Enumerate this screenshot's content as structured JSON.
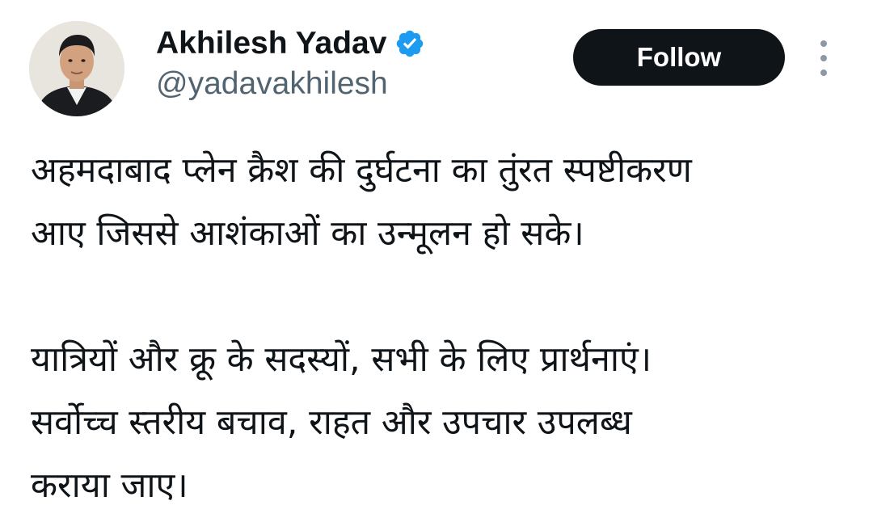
{
  "author": {
    "display_name": "Akhilesh Yadav",
    "handle": "@yadavakhilesh",
    "verified_icon": "verified-badge-icon",
    "avatar_icon": "profile-photo"
  },
  "actions": {
    "follow_label": "Follow",
    "more_icon": "more-vertical-icon"
  },
  "colors": {
    "text_primary": "#0f1419",
    "text_secondary": "#536471",
    "follow_bg": "#0f1419",
    "verified_blue": "#1d9bf0"
  },
  "tweet": {
    "paragraphs": [
      {
        "lines": [
          "अहमदाबाद प्लेन क्रैश की दुर्घटना का तुंरत स्पष्टीकरण",
          "आए जिससे आशंकाओं का उन्मूलन हो सके।"
        ]
      },
      {
        "lines": [
          "यात्रियों और क्रू के सदस्यों, सभी के लिए प्रार्थनाएं।",
          "सर्वोच्च स्तरीय बचाव, राहत और उपचार उपलब्ध",
          "कराया जाए।"
        ]
      }
    ]
  }
}
